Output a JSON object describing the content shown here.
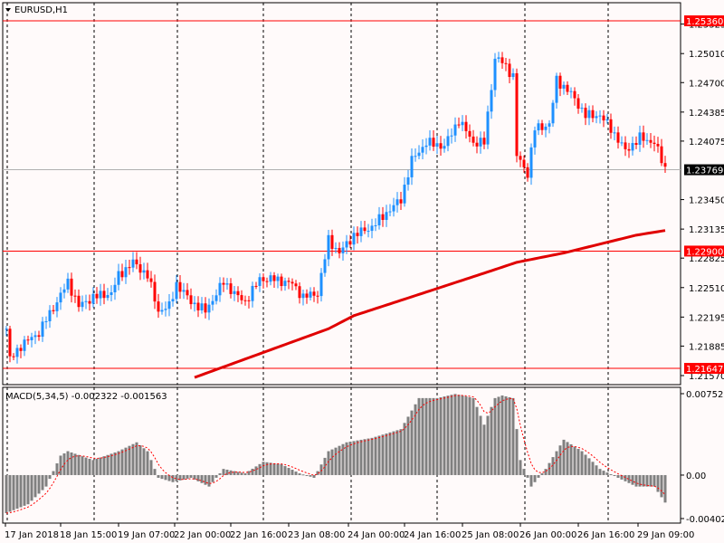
{
  "title": "EURUSD,H1",
  "macd_label": "MACD(5,34,5) -0.002322 -0.001563",
  "colors": {
    "up": "#1e90ff",
    "down": "#ff0000",
    "ma": "#e00000",
    "hist": "#808080",
    "signal": "#ff0000",
    "bg": "#fffafa"
  },
  "price_axis": {
    "min": 1.2157,
    "max": 1.2536,
    "ticks": [
      "1.25325",
      "1.25010",
      "1.24700",
      "1.24385",
      "1.24075",
      "1.23450",
      "1.23135",
      "1.22825",
      "1.22510",
      "1.22195",
      "1.21885",
      "1.21570"
    ]
  },
  "levels": [
    {
      "price": 1.2536,
      "label": "1.25360",
      "color": "#ff0000"
    },
    {
      "price": 1.229,
      "label": "1.22900",
      "color": "#ff0000"
    },
    {
      "price": 1.21647,
      "label": "1.21647",
      "color": "#ff0000"
    },
    {
      "price": 1.23769,
      "label": "1.23769",
      "color": "#000000",
      "line": "#b0b0b0"
    }
  ],
  "macd_axis": {
    "min": -0.00402,
    "max": 0.007529,
    "ticks": [
      "0.007529",
      "0.00",
      "-0.00402"
    ]
  },
  "time_labels": [
    "17 Jan 2018",
    "18 Jan 15:00",
    "19 Jan 07:00",
    "22 Jan 00:00",
    "22 Jan 16:00",
    "23 Jan 08:00",
    "24 Jan 00:00",
    "24 Jan 16:00",
    "25 Jan 08:00",
    "26 Jan 00:00",
    "26 Jan 16:00",
    "29 Jan 09:00"
  ],
  "chart_data": {
    "type": "candlestick",
    "candle_count": 183,
    "close_anchors": [
      [
        0,
        1.2207
      ],
      [
        1,
        1.2174
      ],
      [
        4,
        1.2189
      ],
      [
        9,
        1.2203
      ],
      [
        11,
        1.2217
      ],
      [
        14,
        1.2236
      ],
      [
        17,
        1.2257
      ],
      [
        20,
        1.2231
      ],
      [
        24,
        1.2241
      ],
      [
        29,
        1.2245
      ],
      [
        31,
        1.2264
      ],
      [
        35,
        1.2278
      ],
      [
        39,
        1.2264
      ],
      [
        42,
        1.2226
      ],
      [
        45,
        1.2231
      ],
      [
        47,
        1.2255
      ],
      [
        51,
        1.2236
      ],
      [
        55,
        1.2226
      ],
      [
        60,
        1.2257
      ],
      [
        64,
        1.2241
      ],
      [
        66,
        1.2236
      ],
      [
        70,
        1.226
      ],
      [
        74,
        1.226
      ],
      [
        79,
        1.2255
      ],
      [
        82,
        1.2241
      ],
      [
        86,
        1.2245
      ],
      [
        89,
        1.2302
      ],
      [
        92,
        1.2288
      ],
      [
        96,
        1.2307
      ],
      [
        101,
        1.2316
      ],
      [
        105,
        1.2331
      ],
      [
        109,
        1.2345
      ],
      [
        112,
        1.2387
      ],
      [
        116,
        1.2406
      ],
      [
        121,
        1.2402
      ],
      [
        125,
        1.243
      ],
      [
        129,
        1.2406
      ],
      [
        132,
        1.2406
      ],
      [
        135,
        1.2496
      ],
      [
        137,
        1.2492
      ],
      [
        140,
        1.2477
      ],
      [
        141,
        1.2392
      ],
      [
        144,
        1.2373
      ],
      [
        146,
        1.2421
      ],
      [
        150,
        1.2425
      ],
      [
        152,
        1.2473
      ],
      [
        156,
        1.2458
      ],
      [
        160,
        1.2435
      ],
      [
        164,
        1.2435
      ],
      [
        167,
        1.2421
      ],
      [
        171,
        1.2397
      ],
      [
        175,
        1.2411
      ],
      [
        179,
        1.2406
      ],
      [
        182,
        1.2378
      ]
    ],
    "ma_anchors": [
      [
        52,
        1.2155
      ],
      [
        89,
        1.2207
      ],
      [
        96,
        1.2221
      ],
      [
        119,
        1.225
      ],
      [
        134,
        1.2269
      ],
      [
        141,
        1.2278
      ],
      [
        154,
        1.2288
      ],
      [
        174,
        1.2307
      ],
      [
        182,
        1.2312
      ]
    ],
    "macd_anchors": [
      [
        0,
        -0.00352
      ],
      [
        6,
        -0.0027
      ],
      [
        11,
        -0.00106
      ],
      [
        15,
        0.0018
      ],
      [
        17,
        0.00221
      ],
      [
        24,
        0.00139
      ],
      [
        31,
        0.00221
      ],
      [
        36,
        0.00303
      ],
      [
        39,
        0.00221
      ],
      [
        42,
        -0.00025
      ],
      [
        46,
        -0.00065
      ],
      [
        51,
        -0.00025
      ],
      [
        56,
        -0.00106
      ],
      [
        60,
        0.00057
      ],
      [
        66,
        0.00016
      ],
      [
        71,
        0.00123
      ],
      [
        76,
        0.001
      ],
      [
        81,
        0.00016
      ],
      [
        85,
        -0.00025
      ],
      [
        89,
        0.00221
      ],
      [
        94,
        0.00303
      ],
      [
        101,
        0.00344
      ],
      [
        109,
        0.00425
      ],
      [
        114,
        0.00712
      ],
      [
        119,
        0.00712
      ],
      [
        124,
        0.0075
      ],
      [
        129,
        0.00712
      ],
      [
        132,
        0.00466
      ],
      [
        135,
        0.00712
      ],
      [
        137,
        0.00736
      ],
      [
        140,
        0.00712
      ],
      [
        142,
        0.00139
      ],
      [
        145,
        -0.00106
      ],
      [
        149,
        0.00057
      ],
      [
        152,
        0.00221
      ],
      [
        154,
        0.00327
      ],
      [
        159,
        0.00221
      ],
      [
        164,
        0.00057
      ],
      [
        169,
        -0.00025
      ],
      [
        174,
        -0.00106
      ],
      [
        179,
        -0.00106
      ],
      [
        182,
        -0.00254
      ]
    ]
  }
}
